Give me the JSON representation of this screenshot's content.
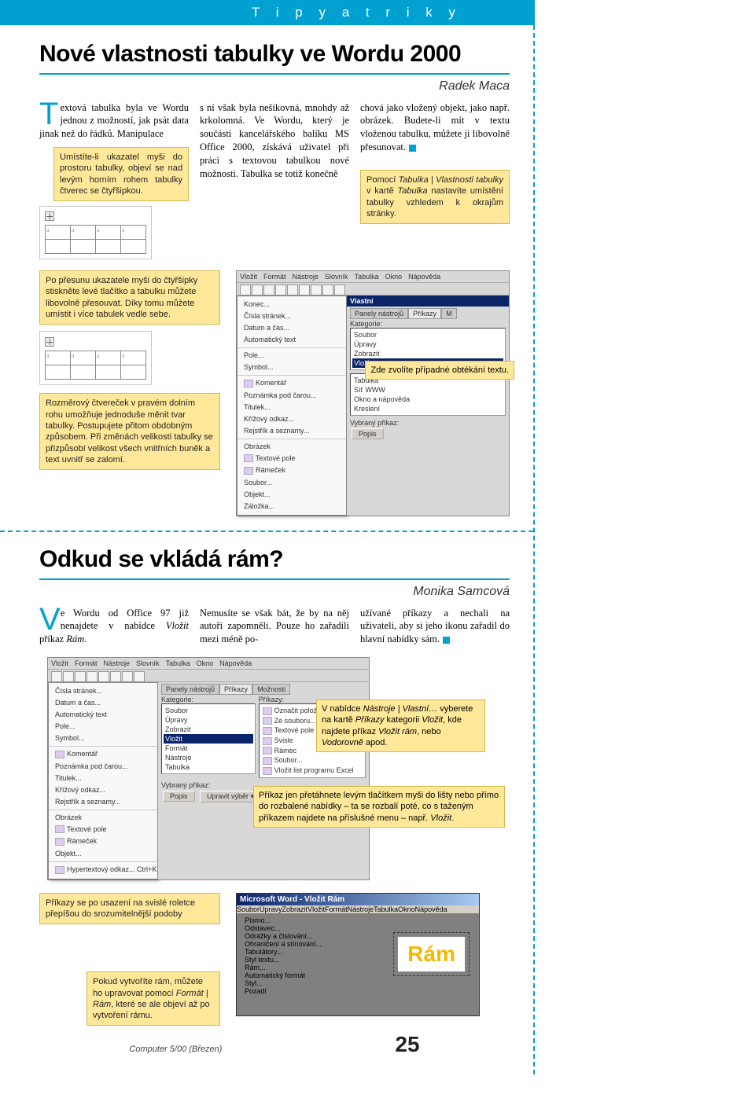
{
  "header": {
    "section_title": "T i p y   a   t r i k y"
  },
  "article1": {
    "title": "Nové vlastnosti tabulky ve Wordu 2000",
    "author": "Radek Maca",
    "dropcap": "T",
    "col1_text": "extová tabulka byla ve Wordu jednou z možností, jak psát data jinak než do řádků. Manipulace",
    "col2_text": "s ní však byla nešikovná, mnohdy až krkolomná. Ve Wordu, který je součástí kancelářského balíku MS Office 2000, získává uživatel při práci s textovou tabulkou nové možnosti. Tabulka se totiž konečně",
    "col3_text": "chová jako vložený objekt, jako např. obrázek. Budete-li mít v textu vloženou tabulku, můžete ji libovolně přesunovat.",
    "callout_hover": "Umístíte-li ukazatel myši do prostoru tabulky, objeví se nad levým horním rohem tabulky čtverec se čtyřšipkou.",
    "callout_vlastnosti_pre": "Pomocí ",
    "callout_vlastnosti_path": "Tabulka | Vlastnosti tabulky",
    "callout_vlastnosti_mid": " v kartě ",
    "callout_vlastnosti_tab": "Tabulka",
    "callout_vlastnosti_post": " nastavíte umístění tabulky vzhledem k okrajům stránky.",
    "callout_move": "Po přesunu ukazatele myši do čtyřšipky stiskněte levé tlačítko a tabulku můžete libovolně přesouvat. Díky tomu můžete umístit i více tabulek vedle sebe.",
    "callout_resize": "Rozměrový čtvereček v pravém dolním rohu umožňuje jednoduše měnit tvar tabulky. Postupujete přitom obdobným způsobem. Při změnách velikosti tabulky se přizpůsobí velikost všech vnitřních buněk a text uvnitř se zalomí.",
    "callout_wrap": "Zde zvolíte případné obtékání textu.",
    "screenshot1": {
      "menubar": [
        "Vložit",
        "Formát",
        "Nástroje",
        "Slovník",
        "Tabulka",
        "Okno",
        "Nápověda"
      ],
      "menu_items": [
        "Konec...",
        "Čísla stránek...",
        "Datum a čas...",
        "Automatický text",
        "Pole...",
        "Symbol...",
        "Komentář",
        "Poznámka pod čarou...",
        "Titulek...",
        "Křížový odkaz...",
        "Rejstřík a seznamy...",
        "Obrázek",
        "Textové pole",
        "Rámeček",
        "Soubor...",
        "Objekt...",
        "Záložka..."
      ],
      "panel_title": "Vlastní",
      "tabs": [
        "Panely nástrojů",
        "Příkazy",
        "M"
      ],
      "label_kategorie": "Kategorie:",
      "list1": [
        "Soubor",
        "Úpravy",
        "Zobrazit",
        "Vložit"
      ],
      "list_hilite1": "Vložit",
      "list2": [
        "Tabulka",
        "Síť WWW",
        "Okno a nápověda",
        "Kreslení"
      ],
      "label_vybrany": "Vybraný příkaz:",
      "btn_popis": "Popis"
    }
  },
  "article2": {
    "title": "Odkud se vkládá rám?",
    "author": "Monika Samcová",
    "dropcap": "V",
    "col1_pre": "e Wordu od Office 97 již nenajdete v nabídce ",
    "col1_i1": "Vložit",
    "col1_mid": " příkaz ",
    "col1_i2": "Rám",
    "col1_post": ".",
    "col2_text": "Nemusíte se však bát, že by na něj autoři zapomněli. Pouze ho zařadili mezi méně po-",
    "col3_text": "užívané příkazy a nechali na uživateli, aby si jeho ikonu zařadil do hlavní nabídky sám.",
    "callout_vlastni_pre": "V nabídce ",
    "callout_vlastni_p1": "Nástroje | Vlastní…",
    "callout_vlastni_mid1": " vyberete na kartě ",
    "callout_vlastni_p2": "Příkazy",
    "callout_vlastni_mid2": " kategorii ",
    "callout_vlastni_p3": "Vložit",
    "callout_vlastni_mid3": ", kde najdete příkaz ",
    "callout_vlastni_p4": "Vložit rám",
    "callout_vlastni_mid4": ", nebo ",
    "callout_vlastni_p5": "Vodorovně",
    "callout_vlastni_post": " apod.",
    "callout_drag": "Příkaz jen přetáhnete levým tlačítkem myši do lišty nebo přímo do rozbalené nabídky – ta se rozbalí poté, co s taženým příkazem najdete na příslušné menu – např. ",
    "callout_drag_i": "Vložit",
    "callout_drag_post": ".",
    "callout_prekres": "Příkazy se po usazení na svislé roletce přepíšou do srozumitelnější podoby",
    "callout_format_pre": "Pokud vytvoříte rám, můžete ho upravovat pomocí ",
    "callout_format_i": "Formát | Rám",
    "callout_format_post": ", které se ale objeví až po vytvoření rámu.",
    "screenshot2": {
      "menubar": [
        "Vložit",
        "Formát",
        "Nástroje",
        "Slovník",
        "Tabulka",
        "Okno",
        "Nápověda"
      ],
      "menu_items": [
        "Čísla stránek...",
        "Datum a čas...",
        "Automatický text",
        "Pole...",
        "Symbol...",
        "Komentář",
        "Poznámka pod čarou...",
        "Titulek...",
        "Křížový odkaz...",
        "Rejstřík a seznamy...",
        "Obrázek",
        "Textové pole",
        "Rámeček",
        "Objekt...",
        "Hypertextový odkaz...   Ctrl+K"
      ],
      "panel_tabs": [
        "Panely nástrojů",
        "Příkazy",
        "Možnosti"
      ],
      "label_kategorie": "Kategorie:",
      "list1": [
        "Soubor",
        "Úpravy",
        "Zobrazit",
        "Vložit",
        "Formát",
        "Nástroje",
        "Tabulka"
      ],
      "list_hilite": "Vložit",
      "label_prikazy": "Příkazy:",
      "list2_items": [
        "Označit položku obsahu...",
        "Ze souboru...",
        "Textové pole",
        "Svisle",
        "Rámec",
        "Soubor...",
        "Vložit list programu Excel"
      ],
      "label_vybrany": "Vybraný příkaz:",
      "btn_popis": "Popis",
      "btn_upravit": "Upravit výběr ▾"
    },
    "screenshot3": {
      "titlebar": "Microsoft Word - Vložit Rám",
      "menubar": [
        "Soubor",
        "Úpravy",
        "Zobrazit",
        "Vložit",
        "Formát",
        "Nástroje",
        "Tabulka",
        "Okno",
        "Nápověda"
      ],
      "format_items": [
        "Písmo...",
        "Odstavec...",
        "Odrážky a číslování...",
        "Ohraničení a stínování...",
        "Tabulátory...",
        "Styl textu...",
        "Rám...",
        "Automatický formát",
        "Styl...",
        "Pozadí"
      ],
      "ram_label": "Rám"
    }
  },
  "footer": {
    "issue": "Computer 5/00 (Březen)",
    "page": "25"
  }
}
